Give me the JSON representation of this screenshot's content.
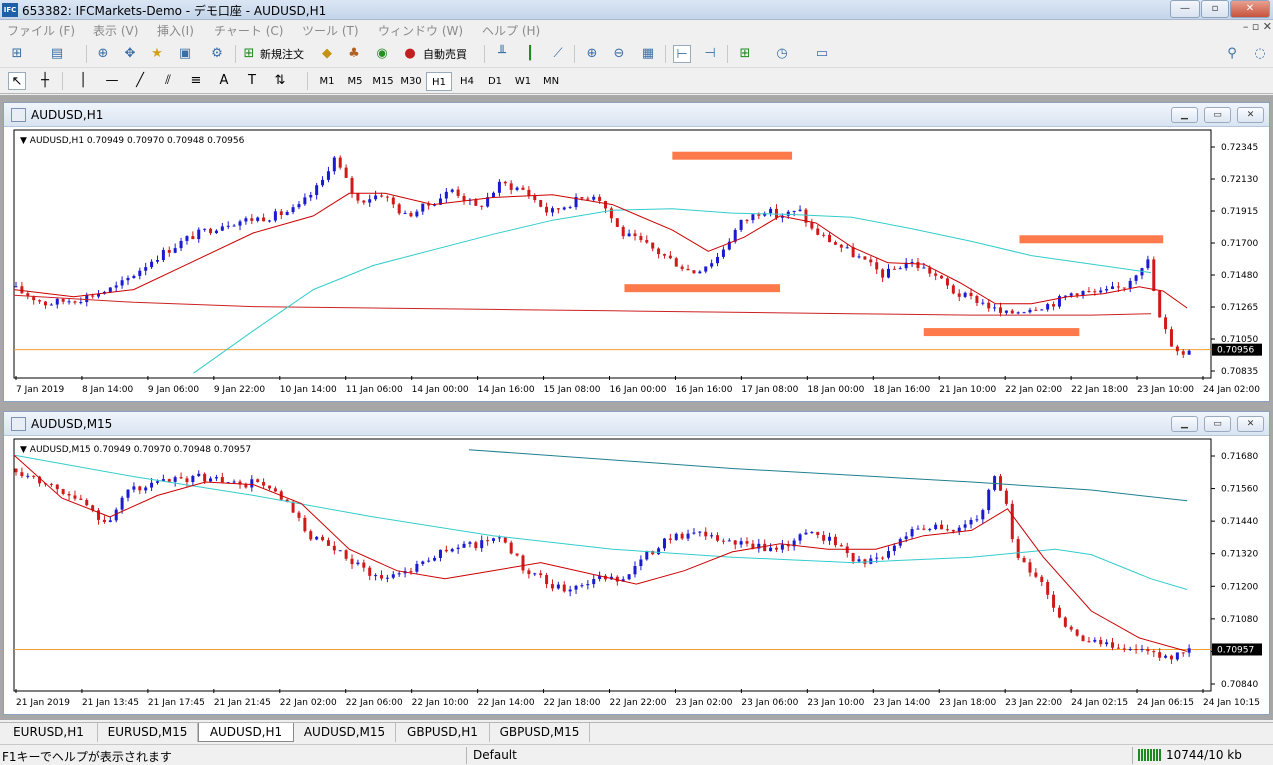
{
  "window": {
    "title": "653382: IFCMarkets-Demo - デモ口座 - AUDUSD,H1",
    "icon_text": "IFC"
  },
  "menu": [
    "ファイル (F)",
    "表示 (V)",
    "挿入(I)",
    "チャート (C)",
    "ツール (T)",
    "ウィンドウ (W)",
    "ヘルプ (H)"
  ],
  "toolbar": {
    "new_order": "新規注文",
    "auto_trading": "自動売買"
  },
  "timeframes": [
    "M1",
    "M5",
    "M15",
    "M30",
    "H1",
    "H4",
    "D1",
    "W1",
    "MN"
  ],
  "active_timeframe": "H1",
  "colors": {
    "bull": "#1a1ad0",
    "bear": "#d01a1a",
    "ma_fast": "#cc0000",
    "ma_mid": "#33cccc",
    "ma_slow": "#cc2222",
    "ma_slow_m15": "#1f7f8f",
    "price_line": "#f0a030",
    "marker": "#ff7a4a"
  },
  "charts": [
    {
      "window_title": "AUDUSD,H1",
      "info": "AUDUSD,H1  0.70949 0.70970 0.70948 0.70956",
      "price_labels": [
        "0.72345",
        "0.72130",
        "0.71915",
        "0.71700",
        "0.71480",
        "0.71265",
        "0.71050",
        "0.70835"
      ],
      "current_price": "0.70956",
      "time_labels": [
        "7 Jan 2019",
        "8 Jan 14:00",
        "9 Jan 06:00",
        "9 Jan 22:00",
        "10 Jan 14:00",
        "11 Jan 06:00",
        "14 Jan 00:00",
        "14 Jan 16:00",
        "15 Jan 08:00",
        "16 Jan 00:00",
        "16 Jan 16:00",
        "17 Jan 08:00",
        "18 Jan 00:00",
        "18 Jan 16:00",
        "21 Jan 10:00",
        "22 Jan 02:00",
        "22 Jan 18:00",
        "23 Jan 10:00",
        "24 Jan 02:00"
      ],
      "ylim": [
        0.7077,
        0.7245
      ],
      "levels": [
        {
          "price": 0.72325,
          "from": 0.55,
          "to": 0.65
        },
        {
          "price": 0.7139,
          "from": 0.51,
          "to": 0.64
        },
        {
          "price": 0.71735,
          "from": 0.84,
          "to": 0.96
        },
        {
          "price": 0.7108,
          "from": 0.76,
          "to": 0.89
        }
      ],
      "ma_mid_path": [
        [
          0.15,
          0.7079
        ],
        [
          0.2,
          0.7109
        ],
        [
          0.25,
          0.7138
        ],
        [
          0.3,
          0.7155
        ],
        [
          0.4,
          0.7177
        ],
        [
          0.45,
          0.7187
        ],
        [
          0.5,
          0.7194
        ],
        [
          0.55,
          0.7195
        ],
        [
          0.6,
          0.7192
        ],
        [
          0.65,
          0.7191
        ],
        [
          0.7,
          0.7189
        ],
        [
          0.75,
          0.7181
        ],
        [
          0.8,
          0.7172
        ],
        [
          0.85,
          0.7162
        ],
        [
          0.9,
          0.7156
        ],
        [
          0.95,
          0.715
        ]
      ],
      "ma_slow_path": [
        [
          0.0,
          0.7134
        ],
        [
          0.1,
          0.7129
        ],
        [
          0.2,
          0.7126
        ],
        [
          0.3,
          0.7125
        ],
        [
          0.4,
          0.7124
        ],
        [
          0.5,
          0.7123
        ],
        [
          0.6,
          0.7122
        ],
        [
          0.7,
          0.7121
        ],
        [
          0.8,
          0.712
        ],
        [
          0.9,
          0.712
        ],
        [
          0.95,
          0.7121
        ]
      ],
      "price_path": [
        [
          0.0,
          0.714
        ],
        [
          0.03,
          0.7128
        ],
        [
          0.06,
          0.7132
        ],
        [
          0.09,
          0.714
        ],
        [
          0.12,
          0.716
        ],
        [
          0.15,
          0.7175
        ],
        [
          0.18,
          0.7185
        ],
        [
          0.22,
          0.719
        ],
        [
          0.24,
          0.7195
        ],
        [
          0.26,
          0.7213
        ],
        [
          0.27,
          0.7232
        ],
        [
          0.29,
          0.72
        ],
        [
          0.31,
          0.7206
        ],
        [
          0.33,
          0.719
        ],
        [
          0.35,
          0.7198
        ],
        [
          0.37,
          0.7209
        ],
        [
          0.39,
          0.7195
        ],
        [
          0.41,
          0.7213
        ],
        [
          0.43,
          0.7208
        ],
        [
          0.45,
          0.7192
        ],
        [
          0.47,
          0.72
        ],
        [
          0.49,
          0.7206
        ],
        [
          0.51,
          0.7178
        ],
        [
          0.53,
          0.717
        ],
        [
          0.55,
          0.716
        ],
        [
          0.57,
          0.715
        ],
        [
          0.59,
          0.716
        ],
        [
          0.61,
          0.7185
        ],
        [
          0.63,
          0.7195
        ],
        [
          0.64,
          0.719
        ],
        [
          0.66,
          0.7193
        ],
        [
          0.67,
          0.718
        ],
        [
          0.69,
          0.717
        ],
        [
          0.71,
          0.716
        ],
        [
          0.73,
          0.7148
        ],
        [
          0.75,
          0.7158
        ],
        [
          0.77,
          0.715
        ],
        [
          0.79,
          0.7135
        ],
        [
          0.81,
          0.713
        ],
        [
          0.83,
          0.712
        ],
        [
          0.85,
          0.7125
        ],
        [
          0.87,
          0.7128
        ],
        [
          0.89,
          0.7137
        ],
        [
          0.91,
          0.7135
        ],
        [
          0.93,
          0.714
        ],
        [
          0.94,
          0.715
        ],
        [
          0.95,
          0.716
        ],
        [
          0.96,
          0.7118
        ],
        [
          0.97,
          0.71
        ],
        [
          0.98,
          0.7092
        ],
        [
          0.985,
          0.7096
        ]
      ],
      "ma_fast_path": [
        [
          0.0,
          0.7138
        ],
        [
          0.05,
          0.7133
        ],
        [
          0.1,
          0.7138
        ],
        [
          0.15,
          0.7158
        ],
        [
          0.2,
          0.7178
        ],
        [
          0.25,
          0.719
        ],
        [
          0.28,
          0.7206
        ],
        [
          0.31,
          0.7206
        ],
        [
          0.35,
          0.7198
        ],
        [
          0.4,
          0.7203
        ],
        [
          0.45,
          0.7205
        ],
        [
          0.5,
          0.7198
        ],
        [
          0.55,
          0.718
        ],
        [
          0.58,
          0.7165
        ],
        [
          0.61,
          0.7175
        ],
        [
          0.64,
          0.719
        ],
        [
          0.67,
          0.7185
        ],
        [
          0.7,
          0.7168
        ],
        [
          0.73,
          0.7157
        ],
        [
          0.76,
          0.7156
        ],
        [
          0.79,
          0.7143
        ],
        [
          0.82,
          0.7128
        ],
        [
          0.85,
          0.7128
        ],
        [
          0.88,
          0.7133
        ],
        [
          0.91,
          0.7135
        ],
        [
          0.94,
          0.714
        ],
        [
          0.96,
          0.7137
        ],
        [
          0.98,
          0.7125
        ]
      ]
    },
    {
      "window_title": "AUDUSD,M15",
      "info": "AUDUSD,M15  0.70949 0.70970 0.70948 0.70957",
      "price_labels": [
        "0.71680",
        "0.71560",
        "0.71440",
        "0.71320",
        "0.71200",
        "0.71080",
        "0.70957",
        "0.70840"
      ],
      "current_price": "0.70957",
      "time_labels": [
        "21 Jan 2019",
        "21 Jan 13:45",
        "21 Jan 17:45",
        "21 Jan 21:45",
        "22 Jan 02:00",
        "22 Jan 06:00",
        "22 Jan 10:00",
        "22 Jan 14:00",
        "22 Jan 18:00",
        "22 Jan 22:00",
        "23 Jan 02:00",
        "23 Jan 06:00",
        "23 Jan 10:00",
        "23 Jan 14:00",
        "23 Jan 18:00",
        "23 Jan 22:00",
        "24 Jan 02:15",
        "24 Jan 06:15",
        "24 Jan 10:15"
      ],
      "ylim": [
        0.7081,
        0.7171
      ],
      "ma_mid_path": [
        [
          0.0,
          0.7168
        ],
        [
          0.1,
          0.716
        ],
        [
          0.2,
          0.7153
        ],
        [
          0.3,
          0.7145
        ],
        [
          0.4,
          0.7138
        ],
        [
          0.5,
          0.7133
        ],
        [
          0.6,
          0.713
        ],
        [
          0.7,
          0.7128
        ],
        [
          0.8,
          0.713
        ],
        [
          0.87,
          0.7133
        ],
        [
          0.9,
          0.7131
        ],
        [
          0.95,
          0.7122
        ],
        [
          0.98,
          0.7118
        ]
      ],
      "ma_slow_path": [
        [
          0.38,
          0.717
        ],
        [
          0.6,
          0.7163
        ],
        [
          0.8,
          0.7158
        ],
        [
          0.9,
          0.7155
        ],
        [
          0.98,
          0.7151
        ]
      ],
      "price_path": [
        [
          0.0,
          0.7163
        ],
        [
          0.03,
          0.7158
        ],
        [
          0.06,
          0.715
        ],
        [
          0.08,
          0.7143
        ],
        [
          0.1,
          0.7155
        ],
        [
          0.13,
          0.7158
        ],
        [
          0.16,
          0.716
        ],
        [
          0.19,
          0.7157
        ],
        [
          0.21,
          0.7158
        ],
        [
          0.23,
          0.715
        ],
        [
          0.25,
          0.7138
        ],
        [
          0.28,
          0.713
        ],
        [
          0.31,
          0.7122
        ],
        [
          0.33,
          0.7125
        ],
        [
          0.36,
          0.7132
        ],
        [
          0.39,
          0.7135
        ],
        [
          0.41,
          0.7138
        ],
        [
          0.43,
          0.7125
        ],
        [
          0.46,
          0.7118
        ],
        [
          0.49,
          0.7122
        ],
        [
          0.51,
          0.7122
        ],
        [
          0.53,
          0.713
        ],
        [
          0.55,
          0.7138
        ],
        [
          0.58,
          0.7138
        ],
        [
          0.61,
          0.7135
        ],
        [
          0.63,
          0.7133
        ],
        [
          0.65,
          0.7135
        ],
        [
          0.67,
          0.714
        ],
        [
          0.69,
          0.7135
        ],
        [
          0.71,
          0.7128
        ],
        [
          0.73,
          0.713
        ],
        [
          0.75,
          0.714
        ],
        [
          0.77,
          0.7142
        ],
        [
          0.79,
          0.714
        ],
        [
          0.81,
          0.7145
        ],
        [
          0.82,
          0.716
        ],
        [
          0.83,
          0.7155
        ],
        [
          0.84,
          0.713
        ],
        [
          0.86,
          0.7122
        ],
        [
          0.88,
          0.7105
        ],
        [
          0.9,
          0.7098
        ],
        [
          0.93,
          0.7097
        ],
        [
          0.95,
          0.7094
        ],
        [
          0.97,
          0.7092
        ],
        [
          0.985,
          0.7096
        ]
      ],
      "ma_fast_path": [
        [
          0.0,
          0.7168
        ],
        [
          0.04,
          0.7152
        ],
        [
          0.08,
          0.7145
        ],
        [
          0.12,
          0.7153
        ],
        [
          0.16,
          0.7158
        ],
        [
          0.2,
          0.7157
        ],
        [
          0.24,
          0.715
        ],
        [
          0.28,
          0.7133
        ],
        [
          0.32,
          0.7125
        ],
        [
          0.36,
          0.7122
        ],
        [
          0.4,
          0.7125
        ],
        [
          0.44,
          0.7128
        ],
        [
          0.48,
          0.7124
        ],
        [
          0.52,
          0.712
        ],
        [
          0.56,
          0.7125
        ],
        [
          0.6,
          0.7132
        ],
        [
          0.64,
          0.7135
        ],
        [
          0.68,
          0.7133
        ],
        [
          0.72,
          0.7133
        ],
        [
          0.76,
          0.7138
        ],
        [
          0.8,
          0.714
        ],
        [
          0.83,
          0.7148
        ],
        [
          0.86,
          0.713
        ],
        [
          0.9,
          0.711
        ],
        [
          0.94,
          0.71
        ],
        [
          0.98,
          0.7095
        ]
      ]
    }
  ],
  "tabs": [
    "EURUSD,H1",
    "EURUSD,M15",
    "AUDUSD,H1",
    "AUDUSD,M15",
    "GBPUSD,H1",
    "GBPUSD,M15"
  ],
  "active_tab": "AUDUSD,H1",
  "status": {
    "help": "F1キーでヘルプが表示されます",
    "profile": "Default",
    "traffic": "10744/10 kb"
  }
}
